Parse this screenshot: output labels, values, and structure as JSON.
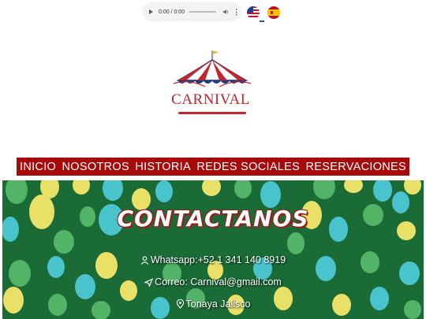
{
  "audio": {
    "time": "0:00 / 0:00"
  },
  "languages": [
    "english-flag",
    "spanish-flag"
  ],
  "logo": {
    "text": "CARNIVAL"
  },
  "nav": {
    "items": [
      "INICIO",
      "NOSOTROS",
      "HISTORIA",
      "REDES SOCIALES",
      "RESERVACIONES"
    ]
  },
  "hero": {
    "title": "CONTACTANOS",
    "whatsapp": "Whatsapp:+52 1 341 140 8919",
    "email": "Correo: Carnival@gmail.com",
    "location": "Tonaya Jalisco"
  },
  "colors": {
    "brand_red": "#a70a0a",
    "hero_green": "#1a6b36",
    "balloon_yellow": "#f5e86a",
    "balloon_cyan": "#4cc9d6",
    "balloon_green": "#56b86a"
  }
}
